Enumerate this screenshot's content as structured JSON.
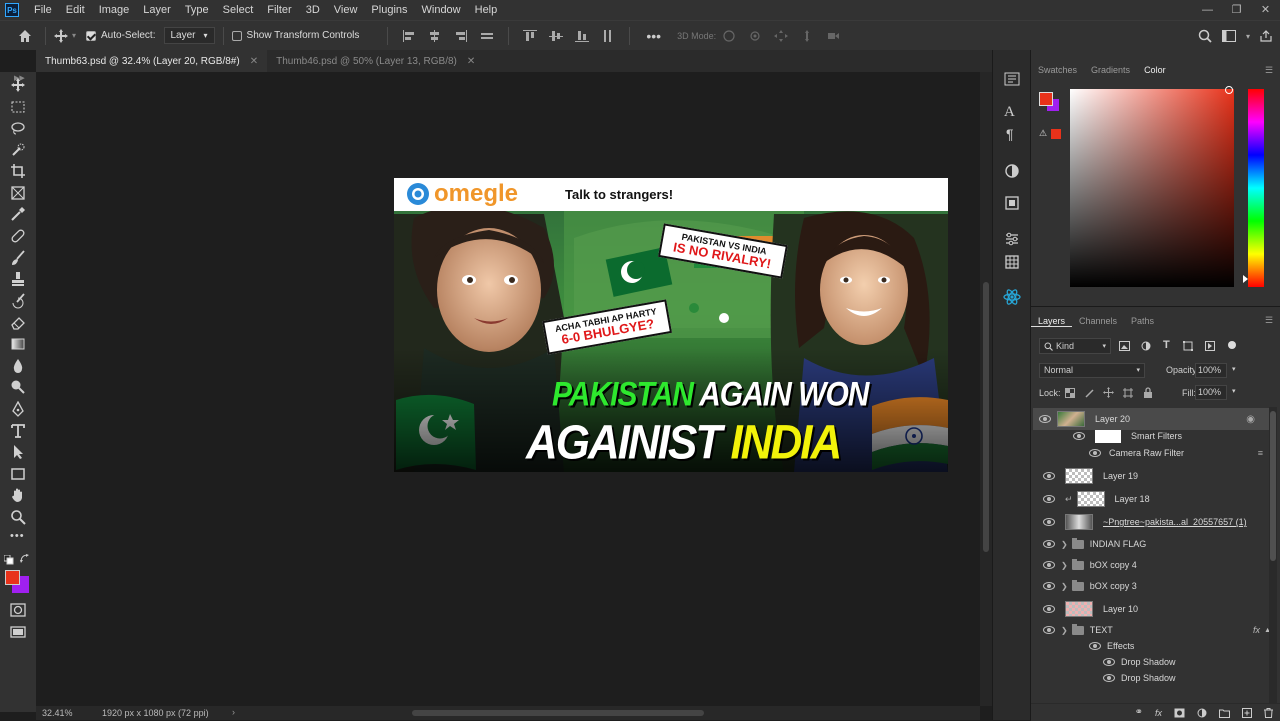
{
  "app": {
    "menu": [
      "File",
      "Edit",
      "Image",
      "Layer",
      "Type",
      "Select",
      "Filter",
      "3D",
      "View",
      "Plugins",
      "Window",
      "Help"
    ],
    "ps_label": "Ps"
  },
  "options": {
    "auto_select_label": "Auto-Select:",
    "auto_select_target": "Layer",
    "show_transform_label": "Show Transform Controls",
    "mode_3d_label": "3D Mode:"
  },
  "tabs": [
    {
      "label": "Thumb63.psd @ 32.4% (Layer 20, RGB/8#)",
      "active": true
    },
    {
      "label": "Thumb46.psd @ 50% (Layer 13, RGB/8)",
      "active": false
    }
  ],
  "status": {
    "zoom": "32.41%",
    "doc_size": "1920 px x 1080 px (72 ppi)"
  },
  "color_panel": {
    "tabs": [
      "Swatches",
      "Gradients",
      "Color"
    ],
    "active_tab": "Color",
    "foreground": "#e8321a",
    "background": "#a020f0"
  },
  "layers_panel": {
    "tabs": [
      "Layers",
      "Channels",
      "Paths"
    ],
    "active_tab": "Layers",
    "filter_kind": "Kind",
    "blend_mode": "Normal",
    "opacity_label": "Opacity:",
    "opacity": "100%",
    "lock_label": "Lock:",
    "fill_label": "Fill:",
    "fill": "100%",
    "layers": [
      {
        "name": "Layer 20",
        "type": "smart"
      },
      {
        "name": "Smart Filters",
        "type": "sub"
      },
      {
        "name": "Camera Raw Filter",
        "type": "sub2"
      },
      {
        "name": "Layer 19",
        "type": "layer"
      },
      {
        "name": "Layer 18",
        "type": "layer"
      },
      {
        "name": "~Pngtree~pakista...al_20557657 (1)",
        "type": "smart"
      },
      {
        "name": "INDIAN FLAG",
        "type": "group"
      },
      {
        "name": "bOX copy 4",
        "type": "group"
      },
      {
        "name": "bOX copy 3",
        "type": "group"
      },
      {
        "name": "Layer 10",
        "type": "layer"
      },
      {
        "name": "TEXT",
        "type": "group"
      },
      {
        "name": "Effects",
        "type": "effects"
      },
      {
        "name": "Drop Shadow",
        "type": "effect"
      },
      {
        "name": "Drop Shadow",
        "type": "effect"
      }
    ]
  },
  "thumbnail": {
    "brand": "omegle",
    "tagline": "Talk to strangers!",
    "bubble1": [
      "PAKISTAN VS INDIA",
      "IS NO RIVALRY!"
    ],
    "bubble2": [
      "ACHA TABHI AP HARTY",
      "6-0 BHULGYE?"
    ],
    "headline_1a": "PAKISTAN",
    "headline_1b": "AGAIN WON",
    "headline_2a": "AGAINIST",
    "headline_2b": "INDIA"
  }
}
